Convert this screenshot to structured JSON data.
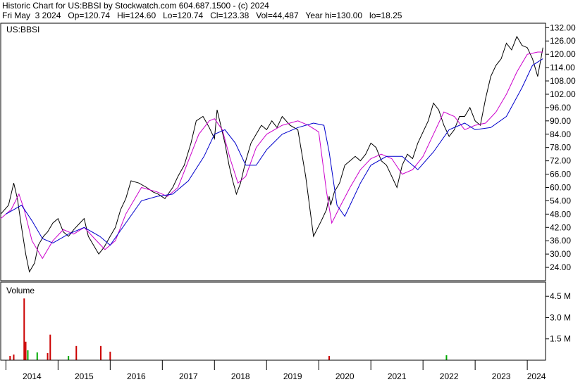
{
  "header": {
    "line1": "Historic Chart for US:BBSI by Stockwatch.com 604.687.1500 - (c) 2024",
    "line2": "Fri May  3 2024   Op=120.74   Hi=124.60   Lo=120.74   Cl=123.38   Vol=44,487   Year hi=130.00   lo=18.25"
  },
  "price_panel": {
    "symbol_label": "US:BBSI"
  },
  "volume_panel": {
    "label": "Volume"
  },
  "colors": {
    "price": "#000000",
    "ma_short": "#cc00cc",
    "ma_long": "#0000cc",
    "vol_up": "#00aa00",
    "vol_down": "#cc0000",
    "grid": "#000000"
  },
  "chart_data": [
    {
      "type": "line",
      "title": "US:BBSI",
      "x_unit": "year",
      "y_ticks": [
        24,
        30,
        36,
        42,
        48,
        54,
        60,
        66,
        72,
        78,
        84,
        90,
        96,
        102,
        108,
        114,
        120,
        126,
        132
      ],
      "y_tick_labels": [
        "24.00",
        "30.00",
        "36.00",
        "42.00",
        "48.00",
        "54.00",
        "60.00",
        "66.00",
        "72.00",
        "78.00",
        "84.00",
        "90.00",
        "96.00",
        "102.00",
        "108.00",
        "114.00",
        "120.00",
        "126.00",
        "132.00"
      ],
      "ylim": [
        18,
        134
      ],
      "xlim": [
        2013.9,
        2024.35
      ],
      "x_ticks": [
        2014,
        2015,
        2016,
        2017,
        2018,
        2019,
        2020,
        2021,
        2022,
        2023,
        2024
      ],
      "x_tick_labels": [
        "2014",
        "2015",
        "2016",
        "2017",
        "2018",
        "2019",
        "2020",
        "2021",
        "2022",
        "2023",
        "2024"
      ],
      "grid": true,
      "series": [
        {
          "style": "price",
          "x": [
            2013.9,
            2014.05,
            2014.15,
            2014.22,
            2014.3,
            2014.38,
            2014.45,
            2014.55,
            2014.62,
            2014.72,
            2014.8,
            2014.9,
            2015.0,
            2015.1,
            2015.2,
            2015.3,
            2015.42,
            2015.5,
            2015.58,
            2015.68,
            2015.78,
            2015.88,
            2016.0,
            2016.1,
            2016.2,
            2016.3,
            2016.4,
            2016.55,
            2016.7,
            2016.82,
            2016.92,
            2017.05,
            2017.2,
            2017.3,
            2017.42,
            2017.55,
            2017.65,
            2017.78,
            2017.9,
            2018.0,
            2018.05,
            2018.1,
            2018.2,
            2018.28,
            2018.35,
            2018.42,
            2018.5,
            2018.6,
            2018.7,
            2018.8,
            2018.9,
            2019.0,
            2019.1,
            2019.2,
            2019.3,
            2019.45,
            2019.6,
            2019.75,
            2019.9,
            2020.05,
            2020.15,
            2020.2,
            2020.23,
            2020.3,
            2020.4,
            2020.5,
            2020.6,
            2020.7,
            2020.8,
            2020.9,
            2021.0,
            2021.1,
            2021.2,
            2021.3,
            2021.4,
            2021.5,
            2021.6,
            2021.7,
            2021.8,
            2021.9,
            2022.0,
            2022.1,
            2022.2,
            2022.3,
            2022.4,
            2022.5,
            2022.6,
            2022.7,
            2022.8,
            2022.9,
            2023.0,
            2023.1,
            2023.2,
            2023.3,
            2023.4,
            2023.5,
            2023.6,
            2023.7,
            2023.8,
            2023.9,
            2024.0,
            2024.1,
            2024.2,
            2024.3
          ],
          "y": [
            48,
            52,
            62,
            55,
            42,
            30,
            22,
            26,
            34,
            38,
            40,
            44,
            46,
            40,
            38,
            41,
            44,
            46,
            38,
            34,
            30,
            33,
            38,
            42,
            50,
            55,
            63,
            62,
            60,
            58,
            57,
            55,
            60,
            65,
            70,
            80,
            90,
            92,
            87,
            82,
            95,
            90,
            80,
            70,
            63,
            57,
            62,
            72,
            80,
            84,
            88,
            86,
            90,
            87,
            92,
            88,
            86,
            65,
            38,
            45,
            50,
            56,
            52,
            58,
            62,
            70,
            72,
            74,
            72,
            75,
            80,
            78,
            72,
            70,
            65,
            60,
            70,
            75,
            73,
            80,
            85,
            90,
            98,
            95,
            88,
            83,
            86,
            92,
            92,
            96,
            90,
            88,
            100,
            110,
            115,
            118,
            125,
            122,
            128,
            124,
            123,
            118,
            110,
            123
          ]
        },
        {
          "style": "ma_short",
          "x": [
            2013.9,
            2014.1,
            2014.25,
            2014.35,
            2014.5,
            2014.7,
            2014.9,
            2015.1,
            2015.3,
            2015.5,
            2015.7,
            2015.9,
            2016.1,
            2016.3,
            2016.6,
            2016.9,
            2017.1,
            2017.3,
            2017.5,
            2017.7,
            2017.9,
            2018.0,
            2018.15,
            2018.3,
            2018.45,
            2018.6,
            2018.8,
            2019.0,
            2019.3,
            2019.6,
            2019.8,
            2020.0,
            2020.15,
            2020.25,
            2020.4,
            2020.6,
            2020.8,
            2021.0,
            2021.2,
            2021.4,
            2021.6,
            2021.8,
            2022.0,
            2022.2,
            2022.4,
            2022.6,
            2022.8,
            2023.0,
            2023.2,
            2023.4,
            2023.6,
            2023.8,
            2024.0,
            2024.2,
            2024.3
          ],
          "y": [
            46,
            50,
            57,
            50,
            36,
            28,
            36,
            41,
            39,
            42,
            37,
            32,
            36,
            48,
            60,
            58,
            56,
            60,
            72,
            84,
            90,
            91,
            86,
            73,
            62,
            65,
            78,
            84,
            88,
            90,
            88,
            85,
            58,
            44,
            51,
            60,
            68,
            73,
            75,
            73,
            66,
            68,
            74,
            84,
            94,
            92,
            86,
            88,
            89,
            94,
            102,
            112,
            120,
            121,
            121
          ]
        },
        {
          "style": "ma_long",
          "x": [
            2014.0,
            2014.3,
            2014.5,
            2014.7,
            2014.9,
            2015.2,
            2015.5,
            2015.8,
            2016.0,
            2016.3,
            2016.6,
            2016.9,
            2017.2,
            2017.5,
            2017.8,
            2018.0,
            2018.2,
            2018.4,
            2018.6,
            2018.8,
            2019.0,
            2019.3,
            2019.6,
            2019.9,
            2020.1,
            2020.2,
            2020.35,
            2020.5,
            2020.8,
            2021.0,
            2021.3,
            2021.6,
            2021.9,
            2022.2,
            2022.5,
            2022.8,
            2023.0,
            2023.3,
            2023.6,
            2023.9,
            2024.1,
            2024.3
          ],
          "y": [
            48,
            52,
            45,
            37,
            35,
            39,
            42,
            38,
            34,
            44,
            54,
            56,
            57,
            63,
            74,
            84,
            86,
            80,
            70,
            70,
            77,
            84,
            87,
            89,
            88,
            76,
            52,
            47,
            62,
            70,
            74,
            74,
            68,
            76,
            86,
            89,
            86,
            87,
            92,
            105,
            115,
            118
          ]
        }
      ]
    },
    {
      "type": "bar",
      "title": "Volume",
      "y_ticks": [
        1.5,
        3.0,
        4.5
      ],
      "y_tick_labels": [
        "1.5 M",
        "3.0 M",
        "4.5 M"
      ],
      "ylim": [
        0,
        5.5
      ],
      "xlim": [
        2013.9,
        2024.35
      ],
      "spikes": [
        {
          "x": 2014.08,
          "value": 0.3,
          "color": "down"
        },
        {
          "x": 2014.15,
          "value": 0.4,
          "color": "down"
        },
        {
          "x": 2014.35,
          "value": 4.35,
          "color": "down"
        },
        {
          "x": 2014.38,
          "value": 1.3,
          "color": "down"
        },
        {
          "x": 2014.42,
          "value": 0.7,
          "color": "up"
        },
        {
          "x": 2014.6,
          "value": 0.55,
          "color": "up"
        },
        {
          "x": 2014.8,
          "value": 0.5,
          "color": "down"
        },
        {
          "x": 2014.85,
          "value": 1.8,
          "color": "down"
        },
        {
          "x": 2015.2,
          "value": 0.3,
          "color": "up"
        },
        {
          "x": 2015.35,
          "value": 1.0,
          "color": "down"
        },
        {
          "x": 2015.82,
          "value": 1.0,
          "color": "down"
        },
        {
          "x": 2016.0,
          "value": 0.6,
          "color": "down"
        },
        {
          "x": 2020.2,
          "value": 0.3,
          "color": "down"
        },
        {
          "x": 2022.45,
          "value": 0.35,
          "color": "up"
        }
      ]
    }
  ]
}
